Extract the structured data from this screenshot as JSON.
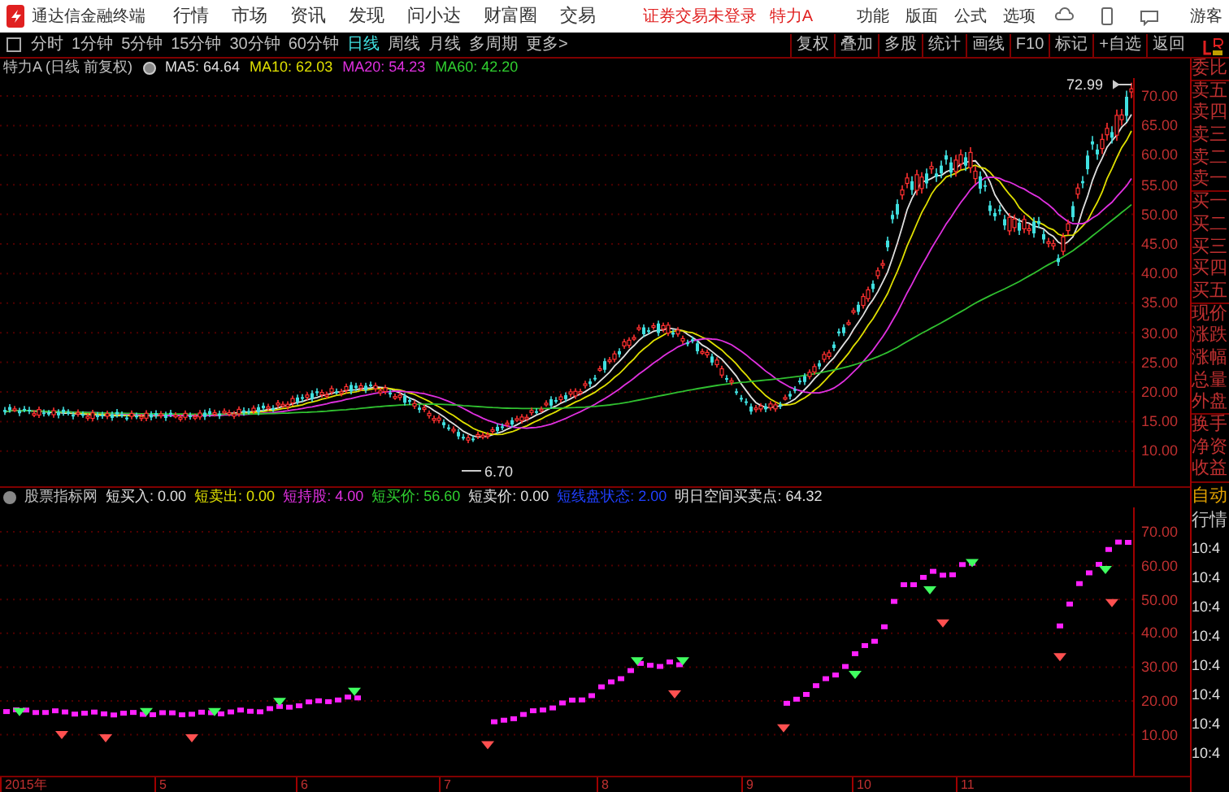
{
  "title_bar": {
    "app_name": "通达信金融终端",
    "menus": [
      "行情",
      "市场",
      "资讯",
      "发现",
      "问小达",
      "财富圈",
      "交易"
    ],
    "login_status": "证券交易未登录",
    "stock": "特力A",
    "right_menus": [
      "功能",
      "版面",
      "公式",
      "选项"
    ],
    "user": "游客"
  },
  "period_tabs": [
    {
      "label": "分时",
      "selected": false
    },
    {
      "label": "1分钟",
      "selected": false
    },
    {
      "label": "5分钟",
      "selected": false
    },
    {
      "label": "15分钟",
      "selected": false
    },
    {
      "label": "30分钟",
      "selected": false
    },
    {
      "label": "60分钟",
      "selected": false
    },
    {
      "label": "日线",
      "selected": true
    },
    {
      "label": "周线",
      "selected": false
    },
    {
      "label": "月线",
      "selected": false
    },
    {
      "label": "多周期",
      "selected": false
    },
    {
      "label": "更多>",
      "selected": false
    }
  ],
  "tool_buttons": [
    "复权",
    "叠加",
    "多股",
    "统计",
    "画线",
    "F10",
    "标记",
    "+自选",
    "返回"
  ],
  "chart_info": {
    "title": "特力A (日线 前复权)",
    "indicators": [
      {
        "label": "MA5: 64.64",
        "color": "#e0e0e0"
      },
      {
        "label": "MA10: 62.03",
        "color": "#e0e000"
      },
      {
        "label": "MA20: 54.23",
        "color": "#e030e0"
      },
      {
        "label": "MA60: 42.20",
        "color": "#30d030"
      }
    ]
  },
  "price_axis": [
    "70.00",
    "65.00",
    "60.00",
    "55.00",
    "50.00",
    "45.00",
    "40.00",
    "35.00",
    "30.00",
    "25.00",
    "20.00",
    "15.00",
    "10.00"
  ],
  "price_high": "72.99",
  "price_low": "6.70",
  "indicator_info": {
    "name": "股票指标网",
    "values": [
      {
        "label": "短买入: 0.00",
        "color": "#e0e0e0"
      },
      {
        "label": "短卖出: 0.00",
        "color": "#e0e000"
      },
      {
        "label": "短持股: 4.00",
        "color": "#e030e0"
      },
      {
        "label": "短买价: 56.60",
        "color": "#30d030"
      },
      {
        "label": "短卖价: 0.00",
        "color": "#e0e0e0"
      },
      {
        "label": "短线盘状态: 2.00",
        "color": "#2040ff"
      },
      {
        "label": "明日空间买卖点: 64.32",
        "color": "#e0e0e0"
      }
    ]
  },
  "indicator_axis": [
    "70.00",
    "60.00",
    "50.00",
    "40.00",
    "30.00",
    "20.00",
    "10.00"
  ],
  "date_axis": [
    "2015年",
    "5",
    "6",
    "7",
    "8",
    "9",
    "10",
    "11"
  ],
  "side_panel": {
    "quote_labels": [
      "委比",
      "卖五",
      "卖四",
      "卖三",
      "卖二",
      "卖一",
      "买一",
      "买二",
      "买三",
      "买四",
      "买五",
      "现价",
      "涨跌",
      "涨幅",
      "总量",
      "外盘",
      "换手",
      "净资",
      "收益"
    ],
    "tabs": [
      "自动",
      "行情"
    ],
    "times": [
      "10:4",
      "10:4",
      "10:4",
      "10:4",
      "10:4",
      "10:4",
      "10:4",
      "10:4"
    ]
  }
}
